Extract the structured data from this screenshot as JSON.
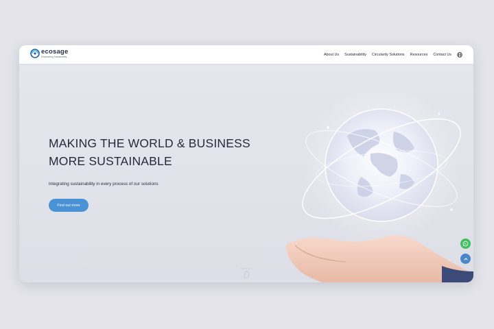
{
  "brand": {
    "name": "ecosage",
    "tagline": "Empowering Sustainability"
  },
  "nav": {
    "items": [
      {
        "label": "About Us"
      },
      {
        "label": "Sustainability"
      },
      {
        "label": "Circularity Solutions"
      },
      {
        "label": "Resources"
      },
      {
        "label": "Contact Us"
      }
    ],
    "language_icon": "globe-icon"
  },
  "hero": {
    "headline_line1": "MAKING THE WORLD & BUSINESS",
    "headline_line2": "MORE SUSTAINABLE",
    "subline": "Integrating sustainability in every process of our solutions",
    "cta_label": "Find out more",
    "scroll_label": "Scroll Down"
  },
  "floating": {
    "whatsapp_icon": "whatsapp-icon",
    "back_to_top_icon": "chevron-up-icon"
  },
  "colors": {
    "accent": "#4a92d6",
    "whatsapp": "#3fbf5e",
    "headline": "#272a3c",
    "background": "#e4e4ea"
  }
}
